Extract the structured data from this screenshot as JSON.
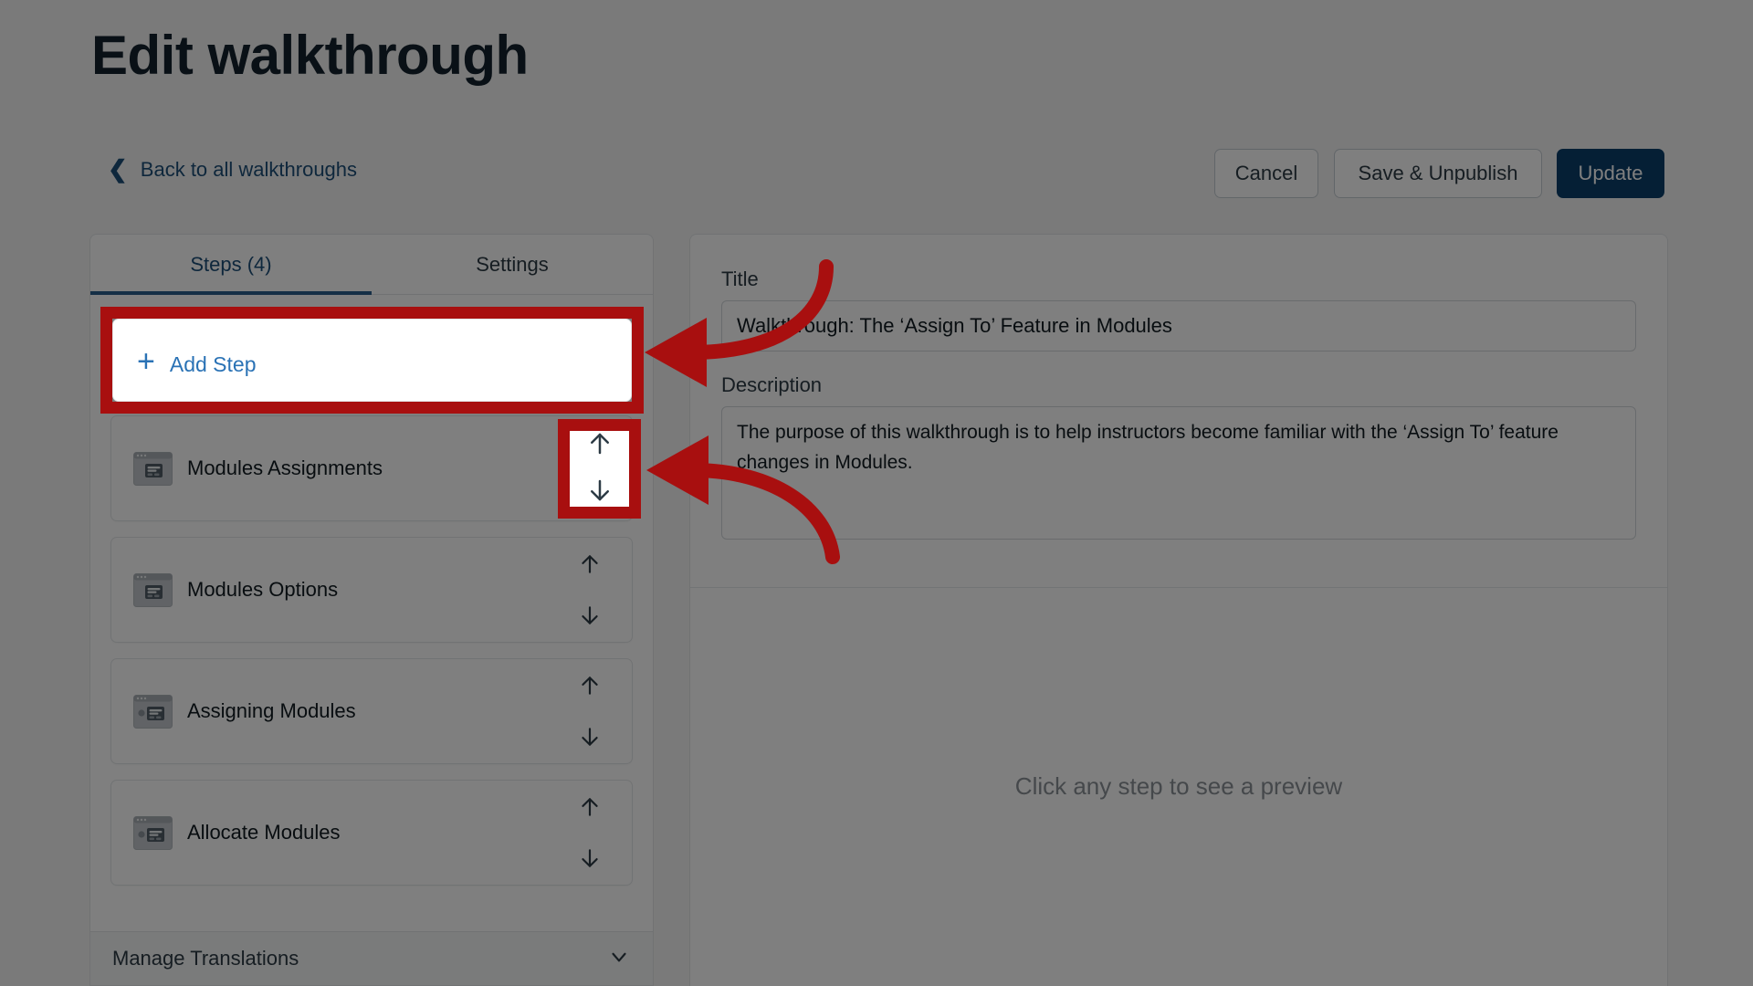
{
  "header": {
    "title": "Edit walkthrough",
    "back_link": "Back to all walkthroughs",
    "back_icon": "chevron-left-icon"
  },
  "actions": {
    "cancel": "Cancel",
    "save_unpublish": "Save & Unpublish",
    "update": "Update",
    "primary_color": "#0b3f6b"
  },
  "left_panel": {
    "tabs": [
      {
        "label": "Steps (4)",
        "active": true
      },
      {
        "label": "Settings",
        "active": false
      }
    ],
    "add_step": {
      "label": "Add Step",
      "icon": "plus-icon"
    },
    "steps": [
      {
        "label": "Modules Assignments",
        "thumb": "browser-modal-thumb"
      },
      {
        "label": "Modules Options",
        "thumb": "browser-modal-thumb"
      },
      {
        "label": "Assigning Modules",
        "thumb": "browser-tooltip-thumb"
      },
      {
        "label": "Allocate Modules",
        "thumb": "browser-tooltip-thumb"
      }
    ],
    "move_up_icon": "arrow-up-icon",
    "move_down_icon": "arrow-down-icon",
    "manage_translations": {
      "label": "Manage Translations",
      "icon": "chevron-down-icon"
    }
  },
  "right_panel": {
    "title_label": "Title",
    "title_value": "Walkthrough: The ‘Assign To’ Feature in Modules",
    "title_placeholder": "Title",
    "description_label": "Description",
    "description_value": "The purpose of this walkthrough is to help instructors become familiar with the ‘Assign To’ feature changes in Modules.",
    "description_placeholder": "Description",
    "preview_empty_text": "Click any step to see a preview"
  },
  "annotations": {
    "highlight_color": "#a80f0f",
    "boxes": [
      {
        "target": "add-step-button"
      },
      {
        "target": "step-move-buttons"
      }
    ],
    "arrows": [
      {
        "from": "title-field",
        "to": "add-step-button"
      },
      {
        "from": "description-field",
        "to": "step-move-buttons"
      }
    ]
  }
}
